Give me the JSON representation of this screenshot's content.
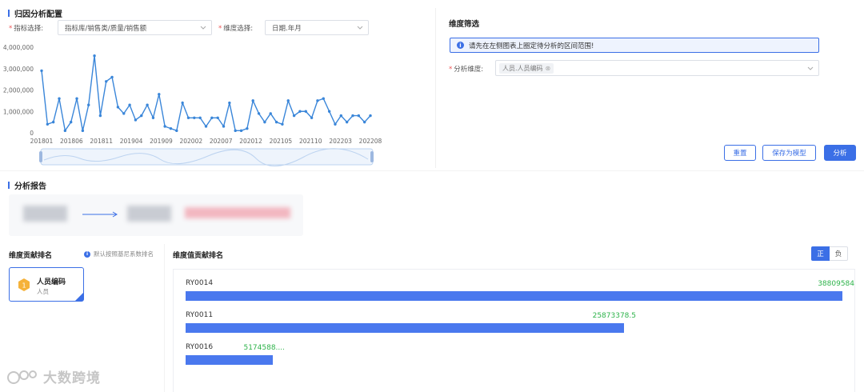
{
  "config": {
    "title": "归因分析配置",
    "metric_label": "指标选择:",
    "metric_value": "指标库/销售类/质量/销售额",
    "dim_label": "维度选择:",
    "dim_value": "日期.年月"
  },
  "chart_data": {
    "type": "line",
    "y_ticks": [
      "4,000,000",
      "3,000,000",
      "2,000,000",
      "1,000,000",
      "0"
    ],
    "x_ticks": [
      "201801",
      "201806",
      "201811",
      "201904",
      "201909",
      "202002",
      "202007",
      "202012",
      "202105",
      "202110",
      "202203",
      "202208"
    ],
    "ylim": [
      0,
      4000000
    ],
    "color": "#3a86d9",
    "values": [
      2900000,
      400000,
      500000,
      1600000,
      100000,
      500000,
      1600000,
      100000,
      1300000,
      3600000,
      800000,
      2400000,
      2600000,
      1200000,
      900000,
      1300000,
      600000,
      800000,
      1300000,
      700000,
      1800000,
      300000,
      200000,
      100000,
      1400000,
      700000,
      700000,
      700000,
      300000,
      700000,
      700000,
      300000,
      1400000,
      100000,
      100000,
      200000,
      1500000,
      900000,
      500000,
      900000,
      500000,
      400000,
      1500000,
      800000,
      1000000,
      1000000,
      700000,
      1500000,
      1600000,
      1000000,
      400000,
      800000,
      500000,
      800000,
      800000,
      500000,
      800000
    ]
  },
  "filter": {
    "title": "维度筛选",
    "info_text": "请先在左侧图表上圈定待分析的区间范围!",
    "dim_label": "分析维度:",
    "dim_tag": "人员.人员编码",
    "reset_label": "重置",
    "save_label": "保存为模型",
    "analyze_label": "分析"
  },
  "report": {
    "title": "分析报告"
  },
  "ranking": {
    "title": "维度贡献排名",
    "hint": "默认按照基尼系数排名",
    "card_title": "人员编码",
    "card_sub": "人员"
  },
  "values": {
    "title": "维度值贡献排名",
    "toggle_pos": "正",
    "toggle_neg": "负",
    "items": [
      {
        "label": "RY0014",
        "value": "38809584",
        "fraction": 1.0
      },
      {
        "label": "RY0011",
        "value": "25873378.5",
        "fraction": 0.667
      },
      {
        "label": "RY0016",
        "value": "5174588....",
        "fraction": 0.133
      }
    ]
  },
  "watermark": "大数跨境"
}
